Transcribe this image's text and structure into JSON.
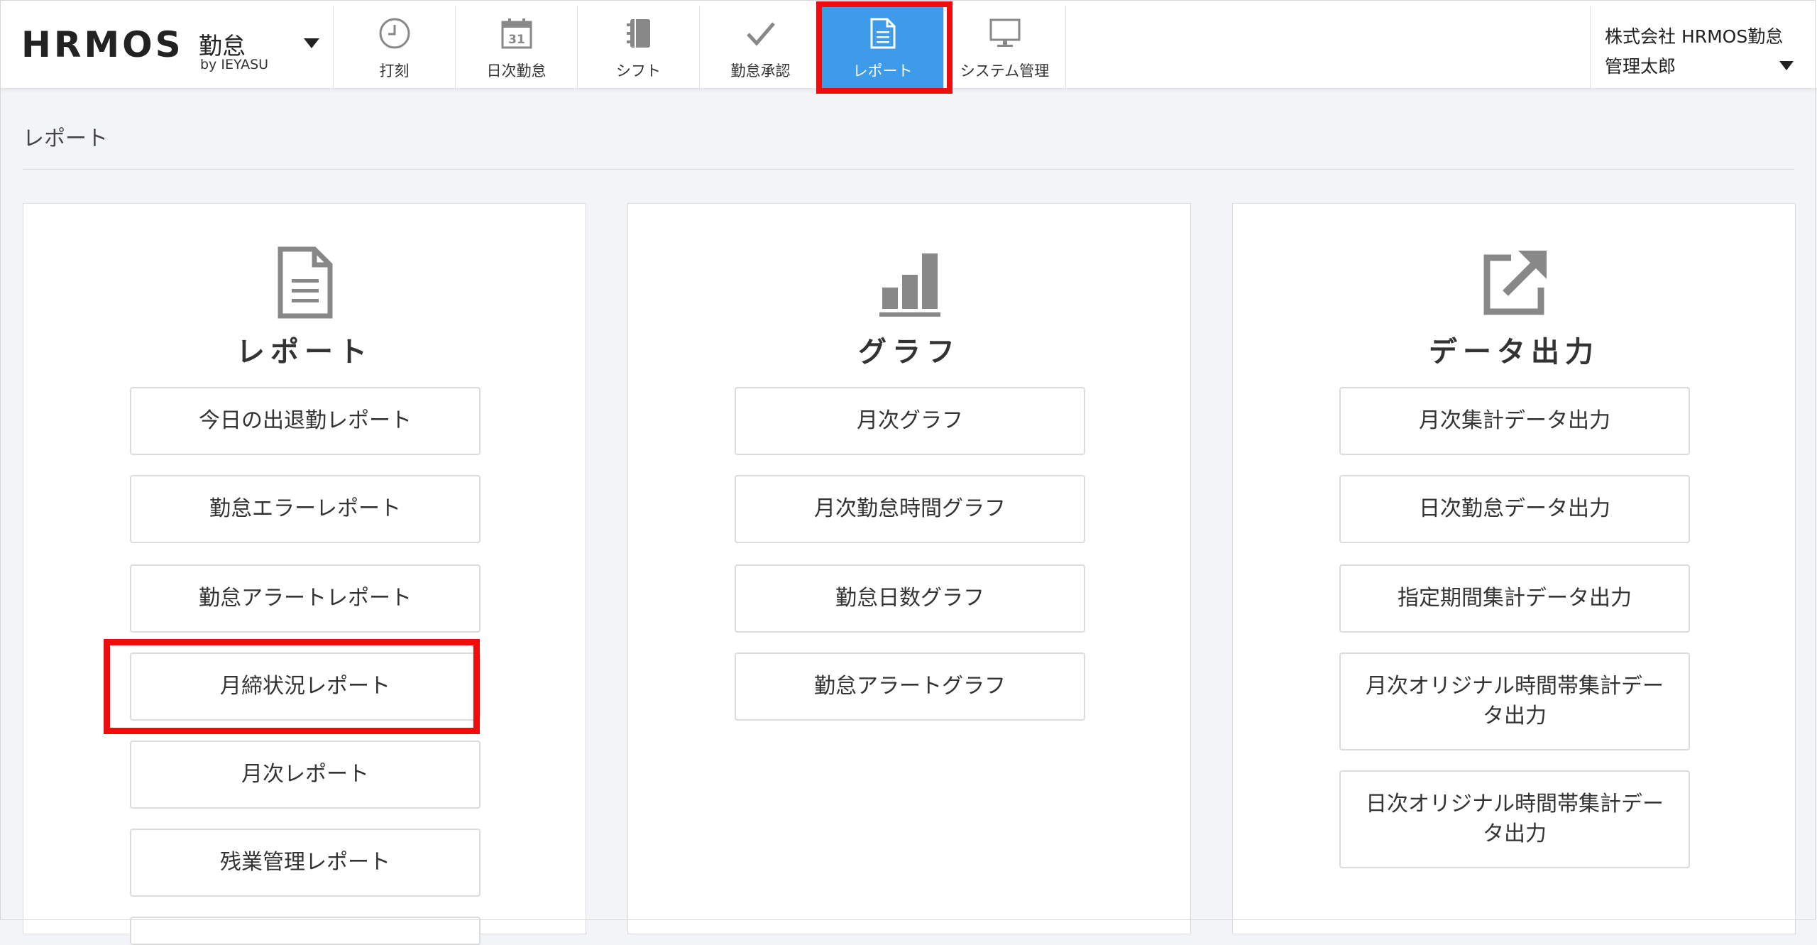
{
  "header": {
    "logo_main": "HRMOS",
    "logo_sub": "勤怠",
    "logo_by": "by IEYASU",
    "nav": [
      {
        "label": "打刻",
        "icon": "clock-icon"
      },
      {
        "label": "日次勤怠",
        "icon": "calendar-icon",
        "icon_text": "31"
      },
      {
        "label": "シフト",
        "icon": "notebook-icon"
      },
      {
        "label": "勤怠承認",
        "icon": "checkmark-icon"
      },
      {
        "label": "レポート",
        "icon": "document-icon",
        "active": true
      },
      {
        "label": "システム管理",
        "icon": "monitor-icon"
      }
    ],
    "user": {
      "company": "株式会社 HRMOS勤怠",
      "name": "管理太郎"
    }
  },
  "page": {
    "title": "レポート"
  },
  "cards": [
    {
      "title": "レポート",
      "icon": "document-icon",
      "buttons": [
        "今日の出退勤レポート",
        "勤怠エラーレポート",
        "勤怠アラートレポート",
        "月締状況レポート",
        "月次レポート",
        "残業管理レポート"
      ]
    },
    {
      "title": "グラフ",
      "icon": "bar-chart-icon",
      "buttons": [
        "月次グラフ",
        "月次勤怠時間グラフ",
        "勤怠日数グラフ",
        "勤怠アラートグラフ"
      ]
    },
    {
      "title": "データ出力",
      "icon": "export-icon",
      "buttons": [
        "月次集計データ出力",
        "日次勤怠データ出力",
        "指定期間集計データ出力",
        "月次オリジナル時間帯集計データ出力",
        "日次オリジナル時間帯集計データ出力"
      ]
    }
  ],
  "colors": {
    "accent": "#3d9be9",
    "highlight": "#ee0c0c",
    "icon_gray": "#888888"
  }
}
